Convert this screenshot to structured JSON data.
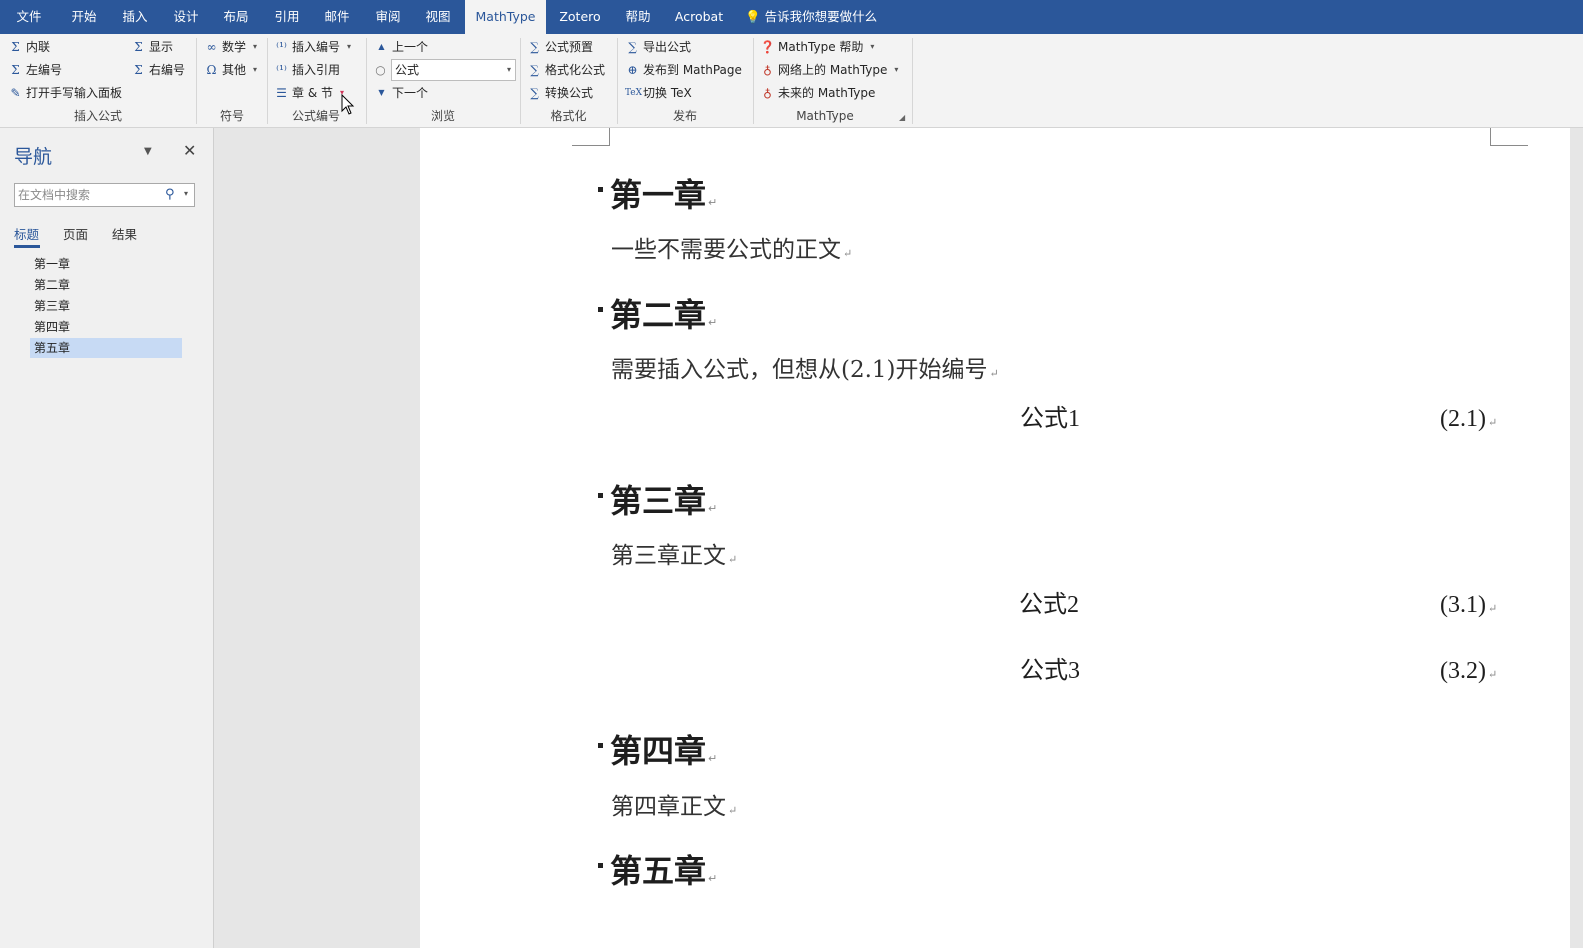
{
  "menu": {
    "tabs": [
      {
        "label": "文件"
      },
      {
        "label": "开始"
      },
      {
        "label": "插入"
      },
      {
        "label": "设计"
      },
      {
        "label": "布局"
      },
      {
        "label": "引用"
      },
      {
        "label": "邮件"
      },
      {
        "label": "审阅"
      },
      {
        "label": "视图"
      },
      {
        "label": "MathType"
      },
      {
        "label": "Zotero"
      },
      {
        "label": "帮助"
      },
      {
        "label": "Acrobat"
      }
    ],
    "active_tab": "MathType",
    "tell_me": "告诉我你想要做什么"
  },
  "ribbon": {
    "insert_equation": {
      "inline": "内联",
      "display": "显示",
      "left_number": "左编号",
      "right_number": "右编号",
      "handwriting": "打开手写输入面板",
      "label": "插入公式"
    },
    "symbols": {
      "math": "数学",
      "other": "其他",
      "label": "符号"
    },
    "equation_numbers": {
      "insert_number": "插入编号",
      "insert_reference": "插入引用",
      "chapter_section": "章 & 节",
      "label": "公式编号"
    },
    "browse": {
      "previous": "上一个",
      "selected": "公式",
      "next": "下一个",
      "label": "浏览"
    },
    "format": {
      "preset": "公式预置",
      "format_equations": "格式化公式",
      "convert": "转换公式",
      "label": "格式化"
    },
    "publish": {
      "export": "导出公式",
      "to_mathpage": "发布到 MathPage",
      "toggle_tex": "切换 TeX",
      "label": "发布"
    },
    "mathtype": {
      "help": "MathType 帮助",
      "online": "网络上的 MathType",
      "future": "未来的 MathType",
      "label": "MathType"
    }
  },
  "nav": {
    "title": "导航",
    "search_placeholder": "在文档中搜索",
    "tabs": [
      {
        "label": "标题"
      },
      {
        "label": "页面"
      },
      {
        "label": "结果"
      }
    ],
    "headings": [
      {
        "label": "第一章"
      },
      {
        "label": "第二章"
      },
      {
        "label": "第三章"
      },
      {
        "label": "第四章"
      },
      {
        "label": "第五章"
      }
    ],
    "selected_heading": "第五章"
  },
  "document": {
    "blocks": [
      {
        "heading": "第一章",
        "text": "一些不需要公式的正文"
      },
      {
        "heading": "第二章",
        "text": "需要插入公式，但想从(2.1)开始编号",
        "equations": [
          {
            "eq": "公式1",
            "num": "(2.1)"
          }
        ]
      },
      {
        "heading": "第三章",
        "text": "第三章正文",
        "equations": [
          {
            "eq": "公式2",
            "num": "(3.1)"
          },
          {
            "eq": "公式3",
            "num": "(3.2)"
          }
        ]
      },
      {
        "heading": "第四章",
        "text": "第四章正文"
      },
      {
        "heading": "第五章"
      }
    ],
    "paragraph_mark": "↵"
  },
  "colors": {
    "accent": "#2b579a",
    "selection": "#c7daf4",
    "ribbon_bg": "#f3f3f3",
    "page": "#ffffff"
  }
}
